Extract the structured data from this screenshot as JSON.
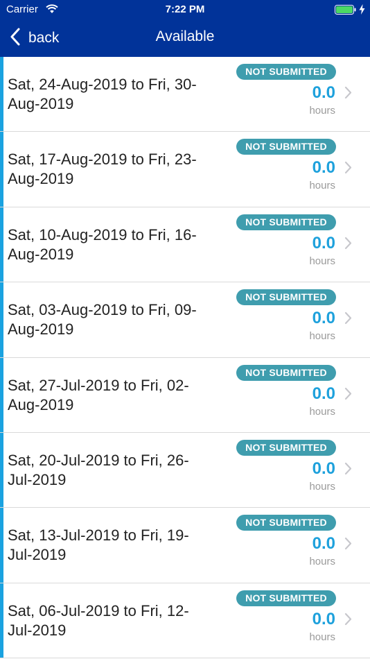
{
  "status_bar": {
    "carrier": "Carrier",
    "time": "7:22 PM"
  },
  "nav": {
    "back_label": "back",
    "title": "Available"
  },
  "colors": {
    "header_bg": "#013399",
    "accent": "#1aa2e0",
    "badge_bg": "#3f9dae",
    "hours_value": "#1ea1dc",
    "battery": "#4cd964"
  },
  "timesheets": [
    {
      "date_line1": "Sat, 24-Aug-2019 to Fri, 30-",
      "date_line2": "Aug-2019",
      "status": "NOT SUBMITTED",
      "hours": "0.0",
      "unit": "hours"
    },
    {
      "date_line1": "Sat, 17-Aug-2019 to Fri, 23-",
      "date_line2": "Aug-2019",
      "status": "NOT SUBMITTED",
      "hours": "0.0",
      "unit": "hours"
    },
    {
      "date_line1": "Sat, 10-Aug-2019 to Fri, 16-",
      "date_line2": "Aug-2019",
      "status": "NOT SUBMITTED",
      "hours": "0.0",
      "unit": "hours"
    },
    {
      "date_line1": "Sat, 03-Aug-2019 to Fri, 09-",
      "date_line2": "Aug-2019",
      "status": "NOT SUBMITTED",
      "hours": "0.0",
      "unit": "hours"
    },
    {
      "date_line1": "Sat, 27-Jul-2019 to Fri, 02-",
      "date_line2": "Aug-2019",
      "status": "NOT SUBMITTED",
      "hours": "0.0",
      "unit": "hours"
    },
    {
      "date_line1": "Sat, 20-Jul-2019 to Fri, 26-",
      "date_line2": "Jul-2019",
      "status": "NOT SUBMITTED",
      "hours": "0.0",
      "unit": "hours"
    },
    {
      "date_line1": "Sat, 13-Jul-2019 to Fri, 19-",
      "date_line2": "Jul-2019",
      "status": "NOT SUBMITTED",
      "hours": "0.0",
      "unit": "hours"
    },
    {
      "date_line1": "Sat, 06-Jul-2019 to Fri, 12-",
      "date_line2": "Jul-2019",
      "status": "NOT SUBMITTED",
      "hours": "0.0",
      "unit": "hours"
    }
  ]
}
